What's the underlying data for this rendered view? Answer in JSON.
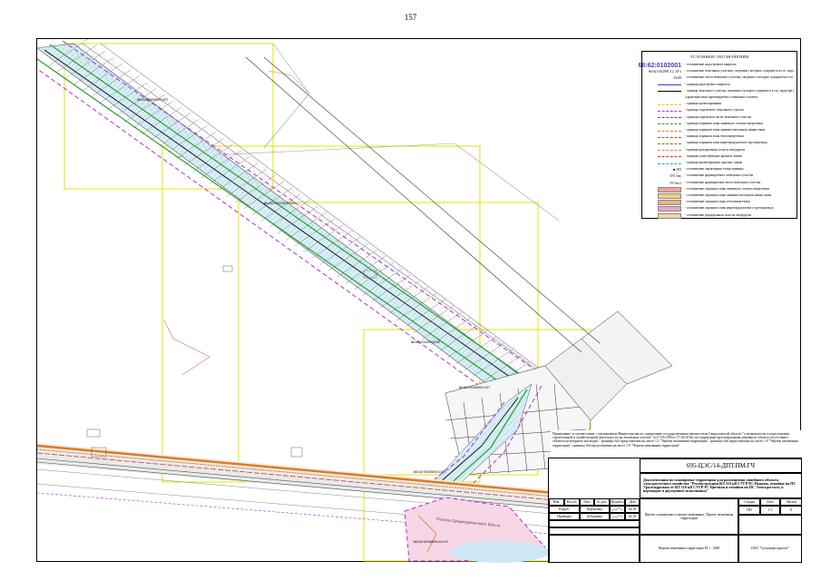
{
  "page_number": "157",
  "legend": {
    "title": "УСЛОВНЫЕ ОБОЗНАЧЕНИЯ",
    "items": [
      {
        "symbol_text": "66:62:0102001",
        "text": "- обозначение кадастрового квартала",
        "color": "#3b3bc4"
      },
      {
        "symbol_text": "66:62:0102001:12 :ЗУ1",
        "text": "- обозначение земельных участков, сведения о которых содержатся в гос. кадастре недвижимости",
        "color": "#000000"
      },
      {
        "symbol_text": "33/49",
        "text": "- обозначение части земельного участка, сведения о которых содержатся в гос. кадастре недвижимости",
        "color": "#000000"
      },
      {
        "symbol_text": "",
        "text": "- граница кадастрового квартала",
        "color": "#3b3bc4"
      },
      {
        "symbol_text": "",
        "text": "- граница земельного участка, сведения о котором содержатся в гос. кадастре недвижимости",
        "color": "#000000"
      },
      {
        "symbol_text": "",
        "text": "Характеристики проектируемого линейного объекта",
        "color": "#000000"
      },
      {
        "symbol_text": "",
        "text": "- граница проектирования",
        "color": "#d6d600"
      },
      {
        "symbol_text": "",
        "text": "- граница образуемого земельного участка",
        "color": "#b030d0"
      },
      {
        "symbol_text": "",
        "text": "- граница образуемой части земельного участка",
        "color": "#8a2a8a"
      },
      {
        "symbol_text": "",
        "text": "- граница охранной зоны линейного объекта энергетики",
        "color": "#2aa02a"
      },
      {
        "symbol_text": "",
        "text": "- граница охранной зоны линейно-кабельной линии связи",
        "color": "#e07a1a"
      },
      {
        "symbol_text": "",
        "text": "- граница охранной зоны теплоэнергетики",
        "color": "#c04040"
      },
      {
        "symbol_text": "",
        "text": "- граница охранной зоны нефтепродуктового трубопровода",
        "color": "#808000"
      },
      {
        "symbol_text": "",
        "text": "- граница придорожной полосы автодороги",
        "color": "#d08080"
      },
      {
        "symbol_text": "",
        "text": "- граница существующих красных линий",
        "color": "#e02020"
      },
      {
        "symbol_text": "",
        "text": "- граница проектируемых красных линий",
        "color": "#20a0d0"
      },
      {
        "symbol_text": "■ 293",
        "text": "- обозначение характерной точки границы",
        "color": "#000000"
      },
      {
        "symbol_text": "ЗУ1/чзу",
        "text": "- обозначение формируемого земельного участка",
        "color": "#000000"
      },
      {
        "symbol_text": "ЗУ/чзу1",
        "text": "- обозначение формируемой части земельного участка",
        "color": "#000000"
      },
      {
        "symbol_text": "",
        "text": "- обозначение охранной зоны линейного объекта энергетики",
        "color": "#f4a0a0"
      },
      {
        "symbol_text": "",
        "text": "- обозначение охранной зоны линейно-кабельной линии связи",
        "color": "#f0d080"
      },
      {
        "symbol_text": "",
        "text": "- обозначение охранной зоны теплоэнергетики",
        "color": "#f0b080"
      },
      {
        "symbol_text": "",
        "text": "- обозначение охранной зоны нефтепродуктового трубопровода",
        "color": "#e8a8c8"
      },
      {
        "symbol_text": "",
        "text": "- обозначение придорожной полосы автодороги",
        "color": "#e8d8a8"
      }
    ]
  },
  "map": {
    "parcel_labels": [
      "66:62:0000000:207",
      "66:62:0102001:105",
      "66:62:0102002:42",
      "66:62:0000000:107",
      "66:62:0000000:105",
      "66:62:0000000:01:97"
    ],
    "road_label": "Полоса Среднеуральского Шоссе"
  },
  "note": {
    "text": "Примечание: в соответствии с заключением Министерства по управлению государственным имуществом Свердловской области \"о возможности осуществления строительной и хозяйственной деятельности на земельном участке\" №17-05-3/90 от 17.03.2016г. на территории проектирования линейного объекта отсутствуют объекты культурного наследия. - границы №6 представлены на листе 1.1 \"Чертеж межевания территории\", границы №6 представлены на листе 1.6 \"Чертеж межевания территории\", границы №6 представлены на листе 1.9 \"Чертеж межевания территории\""
  },
  "stamp": {
    "code": "695-ЦЭС/14-ДПТ.ПМ.ГЧ",
    "title": "Документация по планировке территории для размещения линейного объекта электросетевого хозяйства \"Реконструкция ВЛ 110 кВ СУГРЭС-Пышма, отпайки на ПС Уралгидромаш от ВЛ 110 кВ СУГРЭС-Цветная и отпайки на ПС Электросталь (с переводом в двухцепное исполнение)\"",
    "header_cells": [
      "Изм.",
      "Кол.уч.",
      "Лист",
      "№ док.",
      "Подпись",
      "Дата"
    ],
    "rows": [
      {
        "role": "Разраб.",
        "name": "Корчагина",
        "date": "04.18"
      },
      {
        "role": "Проверил",
        "name": "Бобышева",
        "date": "04.18"
      }
    ],
    "project_label": "Проект планировки и проект межевания. Проект межевания территории",
    "stage_headers": [
      "Стадия",
      "Лист",
      "Листов"
    ],
    "stage_values": [
      "ПП",
      "1.5",
      "11"
    ],
    "sheet_name": "Чертеж межевания территории М 1 : 2000",
    "company": "ООО \"Спецэнергопроект\""
  }
}
